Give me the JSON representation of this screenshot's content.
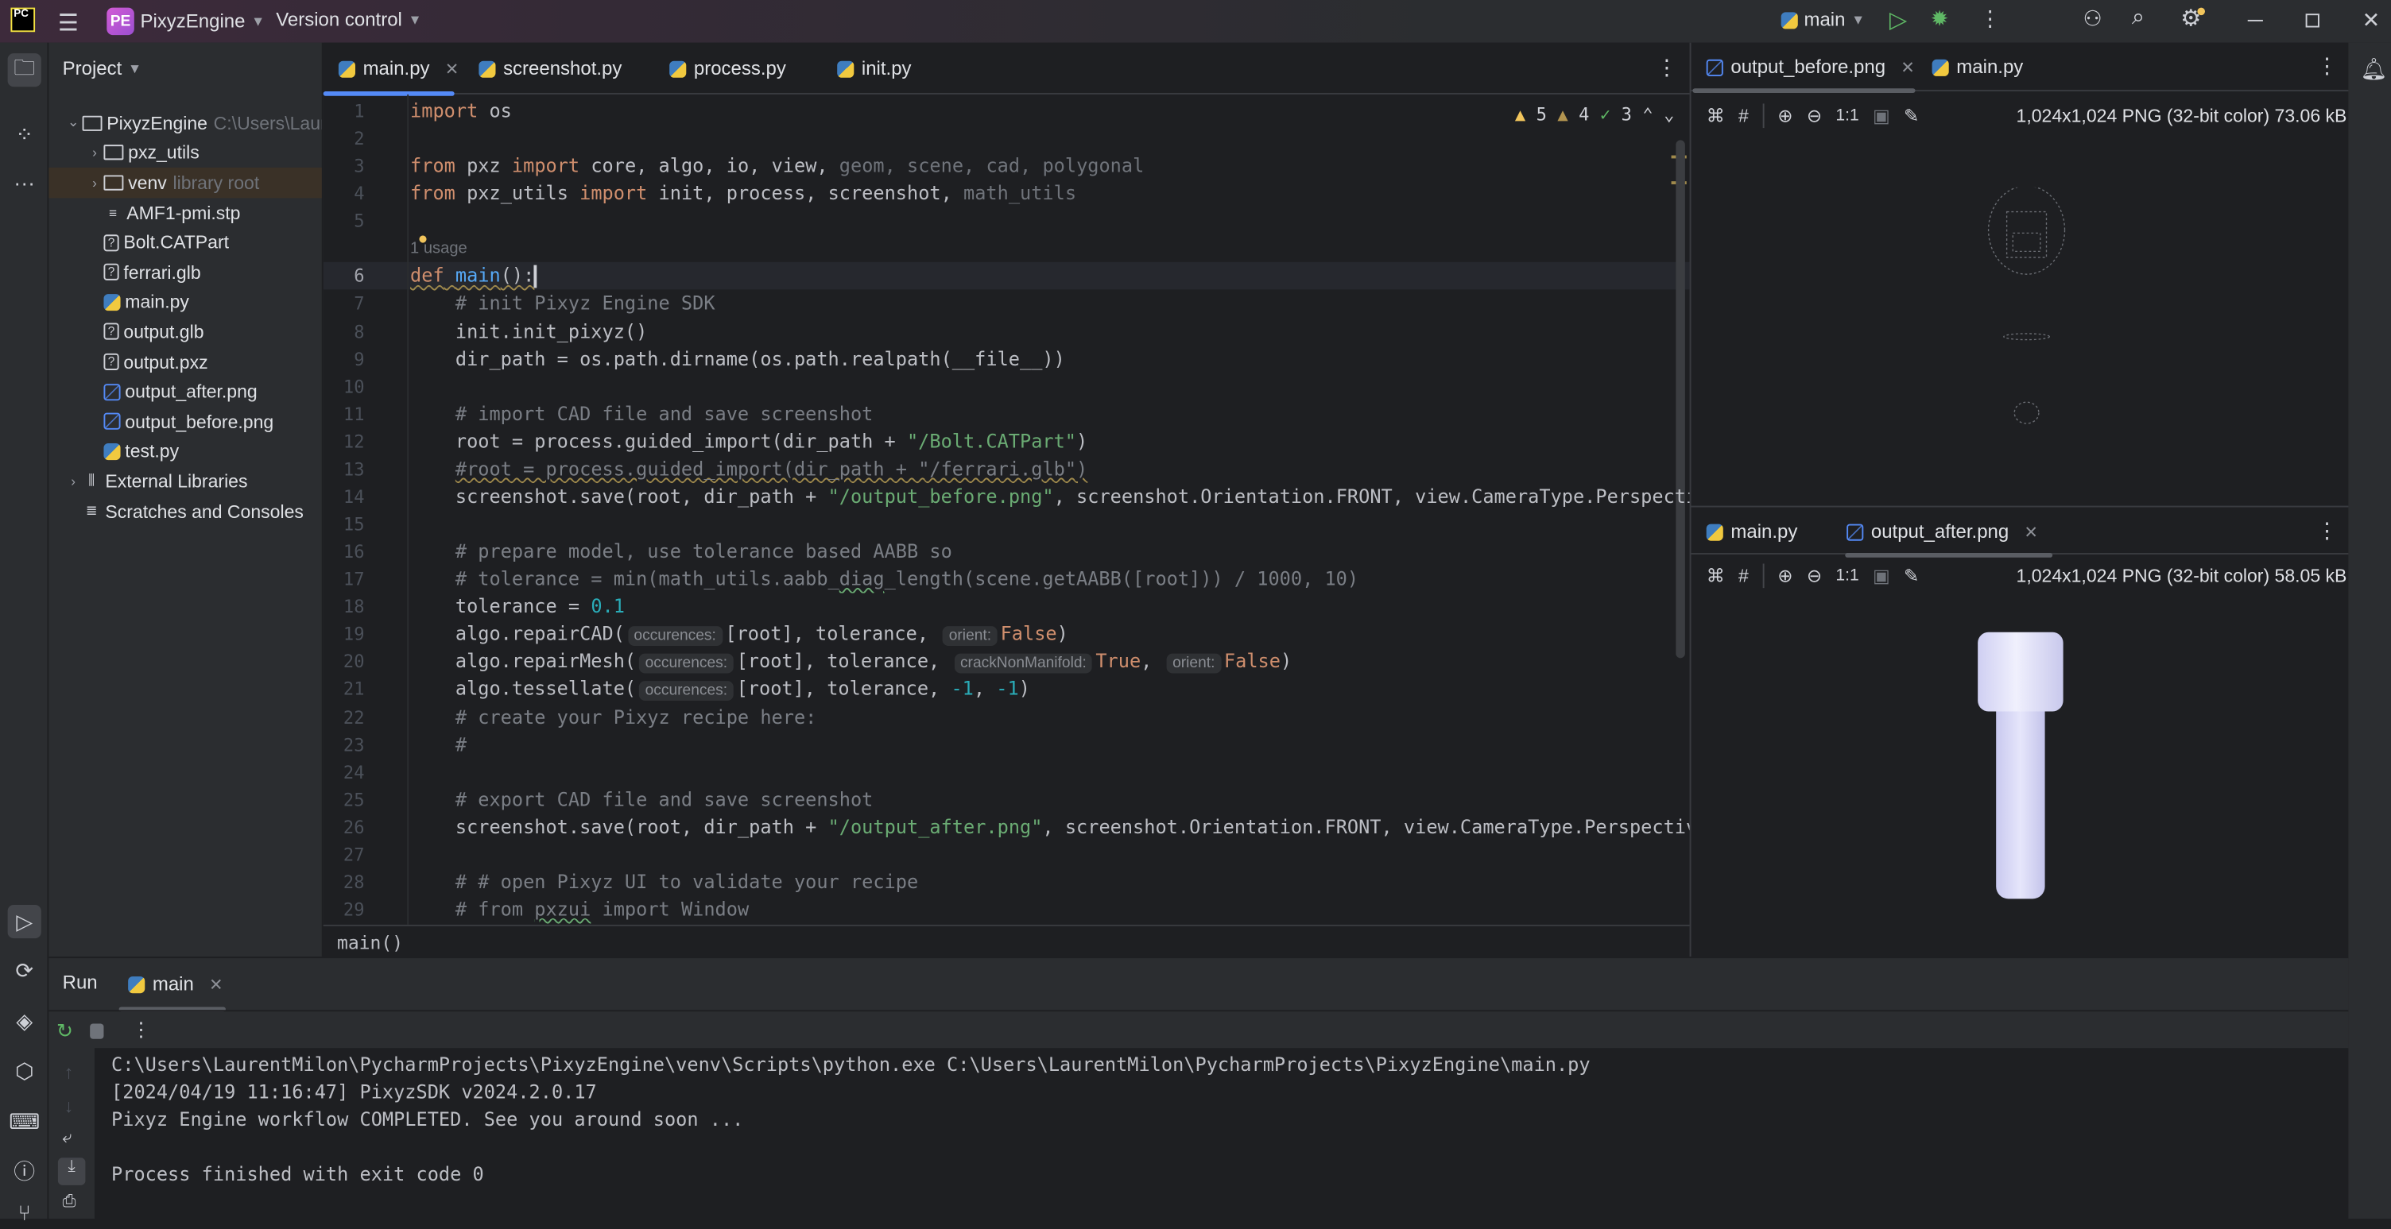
{
  "titlebar": {
    "app_logo": "PC",
    "project_badge": "PE",
    "project_name": "PixyzEngine",
    "vcs": "Version control",
    "run_config": "main",
    "icons": [
      "menu-icon",
      "run-icon",
      "debug-icon",
      "more-icon",
      "add-user-icon",
      "search-icon",
      "settings-icon",
      "minimize-icon",
      "restore-icon",
      "close-icon"
    ]
  },
  "project_panel": {
    "title": "Project",
    "tree": [
      {
        "label": "PixyzEngine",
        "hint": "C:\\Users\\Laur",
        "icon": "folder",
        "arrow": "v",
        "indent": 0
      },
      {
        "label": "pxz_utils",
        "hint": "",
        "icon": "folder",
        "arrow": ">",
        "indent": 1
      },
      {
        "label": "venv",
        "hint": "library root",
        "icon": "folder",
        "arrow": ">",
        "indent": 1,
        "selected": true
      },
      {
        "label": "AMF1-pmi.stp",
        "hint": "",
        "icon": "text",
        "arrow": "",
        "indent": 1
      },
      {
        "label": "Bolt.CATPart",
        "hint": "",
        "icon": "unknown",
        "arrow": "",
        "indent": 1
      },
      {
        "label": "ferrari.glb",
        "hint": "",
        "icon": "unknown",
        "arrow": "",
        "indent": 1
      },
      {
        "label": "main.py",
        "hint": "",
        "icon": "python",
        "arrow": "",
        "indent": 1
      },
      {
        "label": "output.glb",
        "hint": "",
        "icon": "unknown",
        "arrow": "",
        "indent": 1
      },
      {
        "label": "output.pxz",
        "hint": "",
        "icon": "unknown",
        "arrow": "",
        "indent": 1
      },
      {
        "label": "output_after.png",
        "hint": "",
        "icon": "image",
        "arrow": "",
        "indent": 1
      },
      {
        "label": "output_before.png",
        "hint": "",
        "icon": "image",
        "arrow": "",
        "indent": 1
      },
      {
        "label": "test.py",
        "hint": "",
        "icon": "python",
        "arrow": "",
        "indent": 1
      },
      {
        "label": "External Libraries",
        "hint": "",
        "icon": "library",
        "arrow": ">",
        "indent": 0
      },
      {
        "label": "Scratches and Consoles",
        "hint": "",
        "icon": "scratch",
        "arrow": "",
        "indent": 0
      }
    ]
  },
  "editor": {
    "tabs": [
      {
        "label": "main.py",
        "active": true,
        "closable": true
      },
      {
        "label": "screenshot.py"
      },
      {
        "label": "process.py"
      },
      {
        "label": "init.py"
      }
    ],
    "inspections": {
      "warnings": "5",
      "weak_warnings": "4",
      "typos": "3"
    },
    "usage_hint": "1 usage",
    "current_line": 6,
    "lines": [
      {
        "n": "1",
        "t": [
          [
            "import",
            "kw"
          ],
          [
            " os",
            "txt"
          ]
        ]
      },
      {
        "n": "2",
        "t": []
      },
      {
        "n": "3",
        "t": [
          [
            "from",
            "kw"
          ],
          [
            " pxz ",
            "txt"
          ],
          [
            "import",
            "kw"
          ],
          [
            " core, algo, io, view, ",
            "txt"
          ],
          [
            "geom, scene, cad, polygonal",
            "dim"
          ]
        ]
      },
      {
        "n": "4",
        "t": [
          [
            "from",
            "kw"
          ],
          [
            " pxz_utils ",
            "txt"
          ],
          [
            "import",
            "kw"
          ],
          [
            " init, process, screenshot, ",
            "txt"
          ],
          [
            "math_utils",
            "dim"
          ]
        ]
      },
      {
        "n": "5",
        "t": []
      },
      {
        "n": "",
        "usage": true
      },
      {
        "n": "6",
        "t": [
          [
            "def",
            "kw wavyo"
          ],
          [
            " ",
            "txt wavyo"
          ],
          [
            "main",
            "fn wavyo"
          ],
          [
            "():",
            "txt wavyo"
          ]
        ]
      },
      {
        "n": "7",
        "t": [
          [
            "    # init Pixyz Engine SDK",
            "com"
          ]
        ]
      },
      {
        "n": "8",
        "t": [
          [
            "    init.init_pixyz()",
            "txt"
          ]
        ]
      },
      {
        "n": "9",
        "t": [
          [
            "    dir_path = os.path.dirname(os.path.realpath(__file__))",
            "txt"
          ]
        ]
      },
      {
        "n": "10",
        "t": []
      },
      {
        "n": "11",
        "t": [
          [
            "    # import CAD file and save screenshot",
            "com"
          ]
        ]
      },
      {
        "n": "12",
        "t": [
          [
            "    root = process.guided_import(dir_path + ",
            "txt"
          ],
          [
            "\"/Bolt.CATPart\"",
            "str"
          ],
          [
            ")",
            "txt"
          ]
        ]
      },
      {
        "n": "13",
        "t": [
          [
            "    ",
            "txt"
          ],
          [
            "#root = process.guided_import(dir_path + \"/ferrari.glb\")",
            "com wavyo"
          ]
        ]
      },
      {
        "n": "14",
        "t": [
          [
            "    screenshot.save(root, dir_path + ",
            "txt"
          ],
          [
            "\"/output_before.png\"",
            "str"
          ],
          [
            ", screenshot.Orientation.FRONT, view.CameraType.Perspective)",
            "txt"
          ]
        ]
      },
      {
        "n": "15",
        "t": []
      },
      {
        "n": "16",
        "t": [
          [
            "    # prepare model, use tolerance based AABB so",
            "com"
          ]
        ]
      },
      {
        "n": "17",
        "t": [
          [
            "    # tolerance = min(math_utils.aabb_",
            "com"
          ],
          [
            "diag",
            "com wavy"
          ],
          [
            "_length(scene.getAABB([root])) / 1000, 10)",
            "com"
          ]
        ]
      },
      {
        "n": "18",
        "t": [
          [
            "    tolerance = ",
            "txt"
          ],
          [
            "0.1",
            "num"
          ]
        ]
      },
      {
        "n": "19",
        "t": [
          [
            "    algo.repairCAD(",
            "txt"
          ],
          [
            "occurences:",
            "hint"
          ],
          [
            "[root], tolerance, ",
            "txt"
          ],
          [
            "orient:",
            "hint"
          ],
          [
            "False",
            "kw"
          ],
          [
            ")",
            "txt"
          ]
        ]
      },
      {
        "n": "20",
        "t": [
          [
            "    algo.repairMesh(",
            "txt"
          ],
          [
            "occurences:",
            "hint"
          ],
          [
            "[root], tolerance, ",
            "txt"
          ],
          [
            "crackNonManifold:",
            "hint"
          ],
          [
            "True",
            "kw"
          ],
          [
            ", ",
            "txt"
          ],
          [
            "orient:",
            "hint"
          ],
          [
            "False",
            "kw"
          ],
          [
            ")",
            "txt"
          ]
        ]
      },
      {
        "n": "21",
        "t": [
          [
            "    algo.tessellate(",
            "txt"
          ],
          [
            "occurences:",
            "hint"
          ],
          [
            "[root], tolerance, ",
            "txt"
          ],
          [
            "-1",
            "num"
          ],
          [
            ", ",
            "txt"
          ],
          [
            "-1",
            "num"
          ],
          [
            ")",
            "txt"
          ]
        ]
      },
      {
        "n": "22",
        "t": [
          [
            "    # create your Pixyz recipe here:",
            "com"
          ]
        ]
      },
      {
        "n": "23",
        "t": [
          [
            "    #",
            "com"
          ]
        ]
      },
      {
        "n": "24",
        "t": []
      },
      {
        "n": "25",
        "t": [
          [
            "    # export CAD file and save screenshot",
            "com"
          ]
        ]
      },
      {
        "n": "26",
        "t": [
          [
            "    screenshot.save(root, dir_path + ",
            "txt"
          ],
          [
            "\"/output_after.png\"",
            "str"
          ],
          [
            ", screenshot.Orientation.FRONT, view.CameraType.Perspective)",
            "txt"
          ]
        ]
      },
      {
        "n": "27",
        "t": []
      },
      {
        "n": "28",
        "t": [
          [
            "    # # open Pixyz UI to validate your recipe",
            "com"
          ]
        ]
      },
      {
        "n": "29",
        "t": [
          [
            "    # from ",
            "com"
          ],
          [
            "pxzui",
            "com wavy"
          ],
          [
            " import Window",
            "com"
          ]
        ]
      }
    ],
    "breadcrumb": "main()"
  },
  "right_top": {
    "tabs": [
      {
        "label": "output_before.png",
        "active": true,
        "closable": true
      },
      {
        "label": "main.py"
      }
    ],
    "zoom_label": "1:1",
    "info": "1,024x1,024 PNG (32-bit color) 73.06 kB"
  },
  "right_bottom": {
    "tabs": [
      {
        "label": "main.py"
      },
      {
        "label": "output_after.png",
        "active": true,
        "closable": true
      }
    ],
    "zoom_label": "1:1",
    "info": "1,024x1,024 PNG (32-bit color) 58.05 kB"
  },
  "run_panel": {
    "title": "Run",
    "tab": "main",
    "output": [
      "C:\\Users\\LaurentMilon\\PycharmProjects\\PixyzEngine\\venv\\Scripts\\python.exe C:\\Users\\LaurentMilon\\PycharmProjects\\PixyzEngine\\main.py",
      "[2024/04/19 11:16:47] PixyzSDK v2024.2.0.17",
      "Pixyz Engine workflow COMPLETED. See you around soon ...",
      "",
      "Process finished with exit code 0"
    ]
  },
  "colors": {
    "accent": "#548af7",
    "run_green": "#5fb865",
    "keyword": "#cf8e6d",
    "string": "#6aab73",
    "comment": "#7a7e85",
    "number": "#2aacb8",
    "bolt": "#d8d8f6"
  }
}
